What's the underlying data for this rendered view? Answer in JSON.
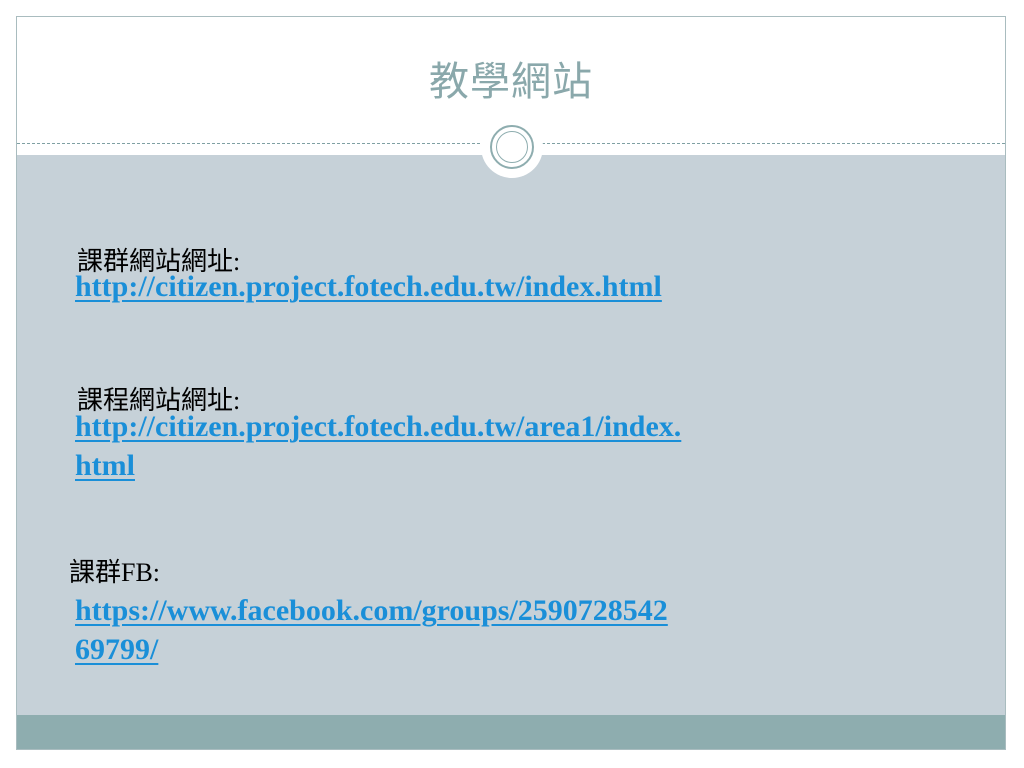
{
  "slide": {
    "title": "教學網站",
    "entries": [
      {
        "label": "課群網站網址:",
        "link_line1": "http://citizen.project.fotech.edu.tw/index.html",
        "link_line2": ""
      },
      {
        "label": "課程網站網址:",
        "link_line1": "http://citizen.project.fotech.edu.tw/area1/index.",
        "link_line2": "html"
      },
      {
        "label": "課群FB:",
        "link_line1": "https://www.facebook.com/groups/2590728542",
        "link_line2": "69799/"
      }
    ]
  },
  "colors": {
    "title": "#8aa8ab",
    "content_background": "#c6d1d8",
    "footer_bar": "#8eadaf",
    "link": "#1a8fd8"
  }
}
